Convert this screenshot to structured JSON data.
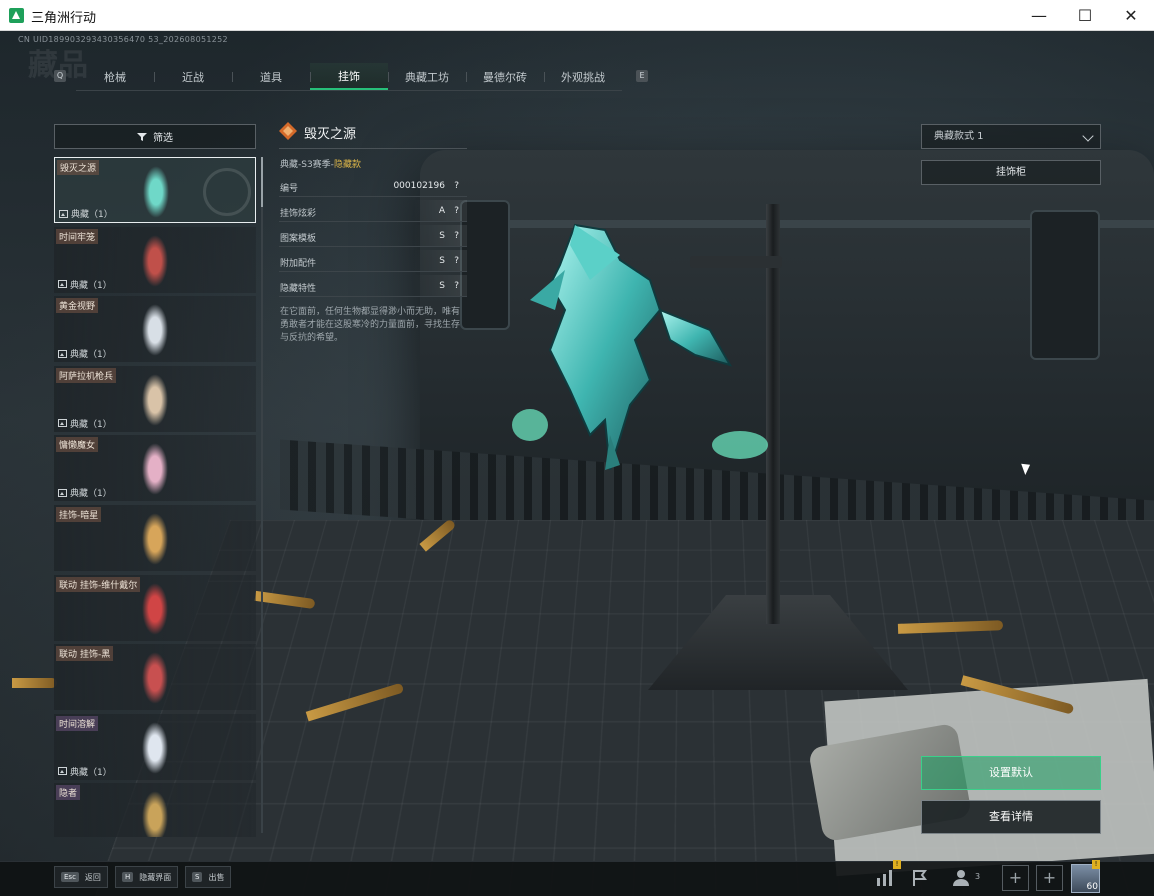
{
  "window": {
    "title": "三角洲行动"
  },
  "header": {
    "uid": "CN UID189903293430356470 53_202608051252",
    "bg_title": "藏品",
    "left_key": "Q",
    "right_key": "E",
    "tabs": [
      {
        "label": "枪械",
        "active": false
      },
      {
        "label": "近战",
        "active": false
      },
      {
        "label": "道具",
        "active": false
      },
      {
        "label": "挂饰",
        "active": true
      },
      {
        "label": "典藏工坊",
        "active": false
      },
      {
        "label": "曼德尔砖",
        "active": false
      },
      {
        "label": "外观挑战",
        "active": false
      }
    ]
  },
  "list": {
    "filter_label": "筛选",
    "items": [
      {
        "name": "毁灭之源",
        "tag": "",
        "count": "典藏（1）",
        "selected": true,
        "purple": false,
        "thumb_color": "#6fd8c8"
      },
      {
        "name": "时间牢笼",
        "tag": "",
        "count": "典藏（1）",
        "selected": false,
        "purple": false,
        "thumb_color": "#c0504a"
      },
      {
        "name": "黄金视野",
        "tag": "",
        "count": "典藏（1）",
        "selected": false,
        "purple": false,
        "thumb_color": "#d8dfe6"
      },
      {
        "name": "阿萨拉机枪兵",
        "tag": "",
        "count": "典藏（1）",
        "selected": false,
        "purple": false,
        "thumb_color": "#d9c3a8"
      },
      {
        "name": "慵懒魔女",
        "tag": "",
        "count": "典藏（1）",
        "selected": false,
        "purple": false,
        "thumb_color": "#e4b0c6"
      },
      {
        "name": "挂饰-暗星",
        "tag": "",
        "count": "",
        "selected": false,
        "purple": false,
        "thumb_color": "#d7a55a"
      },
      {
        "name": "挂饰-维什戴尔",
        "tag": "联动",
        "count": "",
        "selected": false,
        "purple": false,
        "thumb_color": "#d04545"
      },
      {
        "name": "挂饰-黑",
        "tag": "联动",
        "count": "",
        "selected": false,
        "purple": false,
        "thumb_color": "#c85050"
      },
      {
        "name": "时间溶解",
        "tag": "",
        "count": "典藏（1）",
        "selected": false,
        "purple": true,
        "thumb_color": "#dfe6ef"
      },
      {
        "name": "隐者",
        "tag": "",
        "count": "",
        "selected": false,
        "purple": true,
        "thumb_color": "#c9a35a"
      }
    ]
  },
  "detail": {
    "title": "毁灭之源",
    "subtitle_prefix": "典藏-S3赛季-",
    "subtitle_rarity": "隐藏款",
    "attributes": [
      {
        "label": "编号",
        "value": "000102196",
        "q": "?"
      },
      {
        "label": "挂饰炫彩",
        "value": "A",
        "q": "?"
      },
      {
        "label": "图案模板",
        "value": "S",
        "q": "?"
      },
      {
        "label": "附加配件",
        "value": "S",
        "q": "?"
      },
      {
        "label": "隐藏特性",
        "value": "S",
        "q": "?"
      }
    ],
    "description": "在它面前，任何生物都显得渺小而无助，唯有勇敢者才能在这股寒冷的力量面前，寻找生存与反抗的希望。"
  },
  "right": {
    "style_select": "典藏款式 1",
    "rack_button": "挂饰柜",
    "set_default": "设置默认",
    "view_details": "查看详情"
  },
  "bottom": {
    "hints": [
      {
        "key": "Esc",
        "label": "返回"
      },
      {
        "key": "H",
        "label": "隐藏界面"
      },
      {
        "key": "S",
        "label": "出售"
      }
    ],
    "badge": "!",
    "friend_count": "3",
    "level": "60"
  },
  "colors": {
    "accent_green": "#27c07a",
    "rarity_gold": "#d9b449"
  }
}
